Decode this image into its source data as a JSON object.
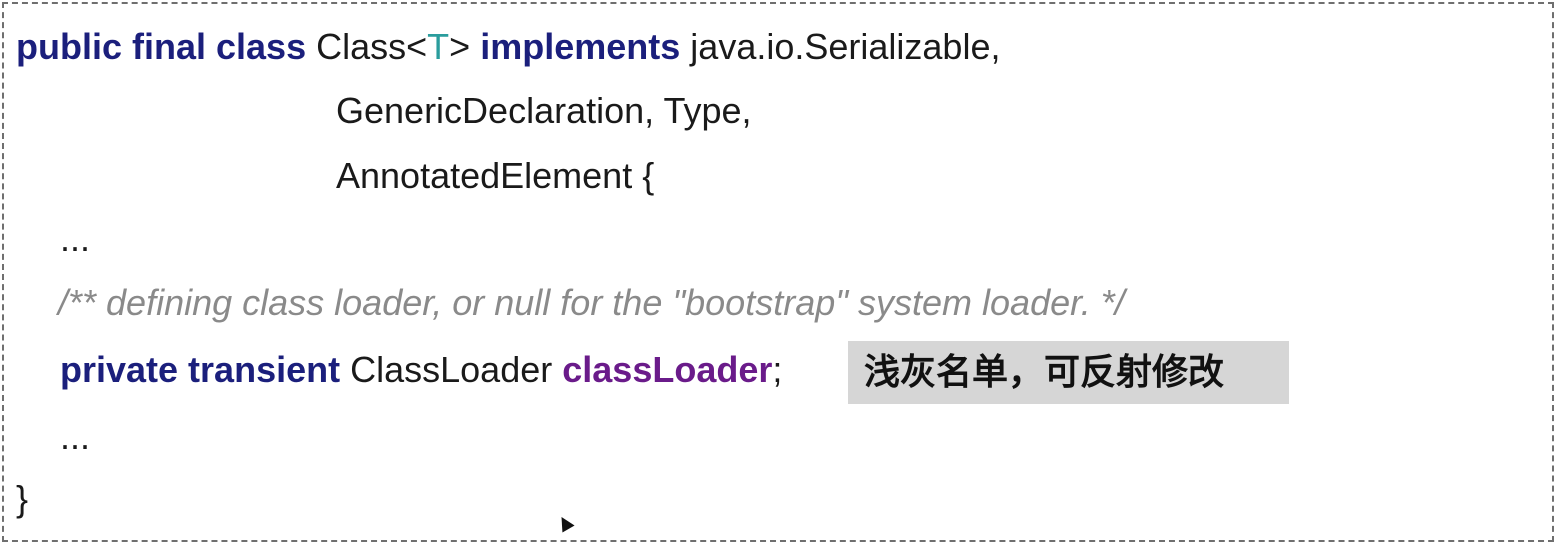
{
  "code": {
    "line1": {
      "kw_modifiers": "public final class",
      "class_name": "Class",
      "lt": "<",
      "type_param": "T",
      "gt": ">",
      "kw_implements": "implements",
      "iface1": "java.io.Serializable,"
    },
    "line2": {
      "ifaces": "GenericDeclaration, Type,"
    },
    "line3": {
      "iface_last": "AnnotatedElement {"
    },
    "line4": {
      "ellipsis": "..."
    },
    "line5": {
      "comment": "/** defining class loader, or null for the \"bootstrap\" system loader. */"
    },
    "line6": {
      "kw_modifiers": "private transient",
      "type": "ClassLoader",
      "field_name": "classLoader",
      "semicolon": ";"
    },
    "line7": {
      "ellipsis": "..."
    },
    "line8": {
      "closing_brace": "}"
    }
  },
  "note": {
    "text": "浅灰名单，可反射修改"
  },
  "colors": {
    "keyword": "#1b1f7c",
    "type_param": "#2a9d9d",
    "field": "#6a1b8a",
    "comment": "#8a8a8a",
    "note_bg": "#d6d6d6"
  }
}
